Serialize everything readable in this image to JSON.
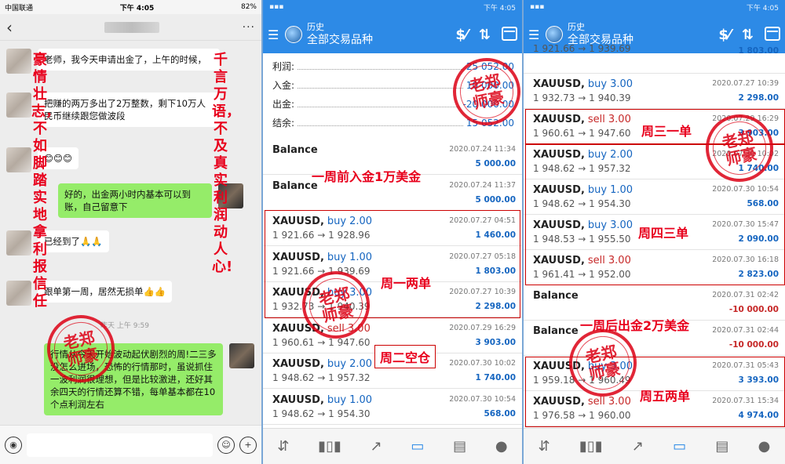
{
  "wechat": {
    "carrier": "中国联通",
    "time": "下午 4:05",
    "battery": "82%",
    "messages": [
      {
        "side": "left",
        "text": "老师，我今天申请出金了，上午的时候，"
      },
      {
        "side": "left",
        "text": "把赚的两万多出了2万整数，剩下10万人民币继续跟您做波段"
      },
      {
        "side": "left",
        "text": "😊😊😊"
      },
      {
        "side": "right",
        "text": "好的，出金两小时内基本可以到账，自己留意下"
      },
      {
        "side": "left",
        "text": "已经到了🙏🙏"
      },
      {
        "side": "left",
        "text": "跟单第一周，居然无损单👍👍"
      },
      {
        "side": "right",
        "text": "行情从今天开始波动起伏剧烈的周!二三多没怎么进场，恐怖的行情那时，虽说抓住一波利润很理想，但是比较激进，还好其余四天的行情还算不错，每单基本都在10个点利润左右"
      }
    ],
    "timestamp": "昨天 上午 9:59",
    "left_slogan": "豪情壮志，不如脚踏实地拿利报信任",
    "right_slogan": "千言万语，不及真实利润动人心!"
  },
  "seal_text": "老郑师豪",
  "mt1": {
    "status_time": "下午 4:05",
    "title_small": "历史",
    "title_main": "全部交易品种",
    "summary": [
      {
        "label": "利润:",
        "value": "25 052.00"
      },
      {
        "label": "入金:",
        "value": "10 000.00"
      },
      {
        "label": "出金:",
        "value": "-20 000.00"
      },
      {
        "label": "结余:",
        "value": "15 052.00"
      }
    ],
    "deals": [
      {
        "symbol": "Balance",
        "type": "",
        "volume": "",
        "prices": "",
        "date": "2020.07.24 11:34",
        "pl": "5 000.00",
        "sign": "pos"
      },
      {
        "symbol": "Balance",
        "type": "",
        "volume": "",
        "prices": "",
        "date": "2020.07.24 11:37",
        "pl": "5 000.00",
        "sign": "pos"
      },
      {
        "symbol": "XAUUSD,",
        "type": "buy",
        "volume": "2.00",
        "prices": "1 921.66 → 1 928.96",
        "date": "2020.07.27 04:51",
        "pl": "1 460.00",
        "sign": "pos"
      },
      {
        "symbol": "XAUUSD,",
        "type": "buy",
        "volume": "1.00",
        "prices": "1 921.66 → 1 939.69",
        "date": "2020.07.27 05:18",
        "pl": "1 803.00",
        "sign": "pos"
      },
      {
        "symbol": "XAUUSD,",
        "type": "buy",
        "volume": "3.00",
        "prices": "1 932.73 → 1 940.39",
        "date": "2020.07.27 10:39",
        "pl": "2 298.00",
        "sign": "pos"
      },
      {
        "symbol": "XAUUSD,",
        "type": "sell",
        "volume": "3.00",
        "prices": "1 960.61 → 1 947.60",
        "date": "2020.07.29 16:29",
        "pl": "3 903.00",
        "sign": "pos"
      },
      {
        "symbol": "XAUUSD,",
        "type": "buy",
        "volume": "2.00",
        "prices": "1 948.62 → 1 957.32",
        "date": "2020.07.30 10:02",
        "pl": "1 740.00",
        "sign": "pos"
      },
      {
        "symbol": "XAUUSD,",
        "type": "buy",
        "volume": "1.00",
        "prices": "1 948.62 → 1 954.30",
        "date": "2020.07.30 10:54",
        "pl": "568.00",
        "sign": "pos"
      }
    ],
    "notes": {
      "deposit": "一周前入金1万美金",
      "monday": "周一两单",
      "tuesday": "周二空仓"
    }
  },
  "mt2": {
    "status_time": "下午 4:05",
    "title_small": "历史",
    "title_main": "全部交易品种",
    "deals": [
      {
        "symbol": "",
        "type": "",
        "volume": "",
        "prices": "1 921.66 → 1 939.69",
        "date": "",
        "pl": "1 803.00",
        "sign": "pos"
      },
      {
        "symbol": "XAUUSD,",
        "type": "buy",
        "volume": "3.00",
        "prices": "1 932.73 → 1 940.39",
        "date": "2020.07.27 10:39",
        "pl": "2 298.00",
        "sign": "pos"
      },
      {
        "symbol": "XAUUSD,",
        "type": "sell",
        "volume": "3.00",
        "prices": "1 960.61 → 1 947.60",
        "date": "2020.07.29 16:29",
        "pl": "3 903.00",
        "sign": "pos"
      },
      {
        "symbol": "XAUUSD,",
        "type": "buy",
        "volume": "2.00",
        "prices": "1 948.62 → 1 957.32",
        "date": "2020.07.30 10:02",
        "pl": "1 740.00",
        "sign": "pos"
      },
      {
        "symbol": "XAUUSD,",
        "type": "buy",
        "volume": "1.00",
        "prices": "1 948.62 → 1 954.30",
        "date": "2020.07.30 10:54",
        "pl": "568.00",
        "sign": "pos"
      },
      {
        "symbol": "XAUUSD,",
        "type": "buy",
        "volume": "3.00",
        "prices": "1 948.53 → 1 955.50",
        "date": "2020.07.30 15:47",
        "pl": "2 090.00",
        "sign": "pos"
      },
      {
        "symbol": "XAUUSD,",
        "type": "sell",
        "volume": "3.00",
        "prices": "1 961.41 → 1 952.00",
        "date": "2020.07.30 16:18",
        "pl": "2 823.00",
        "sign": "pos"
      },
      {
        "symbol": "Balance",
        "type": "",
        "volume": "",
        "prices": "",
        "date": "2020.07.31 02:42",
        "pl": "-10 000.00",
        "sign": "neg"
      },
      {
        "symbol": "Balance",
        "type": "",
        "volume": "",
        "prices": "",
        "date": "2020.07.31 02:44",
        "pl": "-10 000.00",
        "sign": "neg"
      },
      {
        "symbol": "XAUUSD,",
        "type": "buy",
        "volume": "3.00",
        "prices": "1 959.18 → 1 960.49",
        "date": "2020.07.31 05:43",
        "pl": "3 393.00",
        "sign": "pos"
      },
      {
        "symbol": "XAUUSD,",
        "type": "sell",
        "volume": "3.00",
        "prices": "1 976.58 → 1 960.00",
        "date": "2020.07.31 15:34",
        "pl": "4 974.00",
        "sign": "pos"
      }
    ],
    "notes": {
      "wednesday": "周三一单",
      "thursday": "周四三单",
      "withdraw": "一周后出金2万美金",
      "friday": "周五两单"
    }
  }
}
